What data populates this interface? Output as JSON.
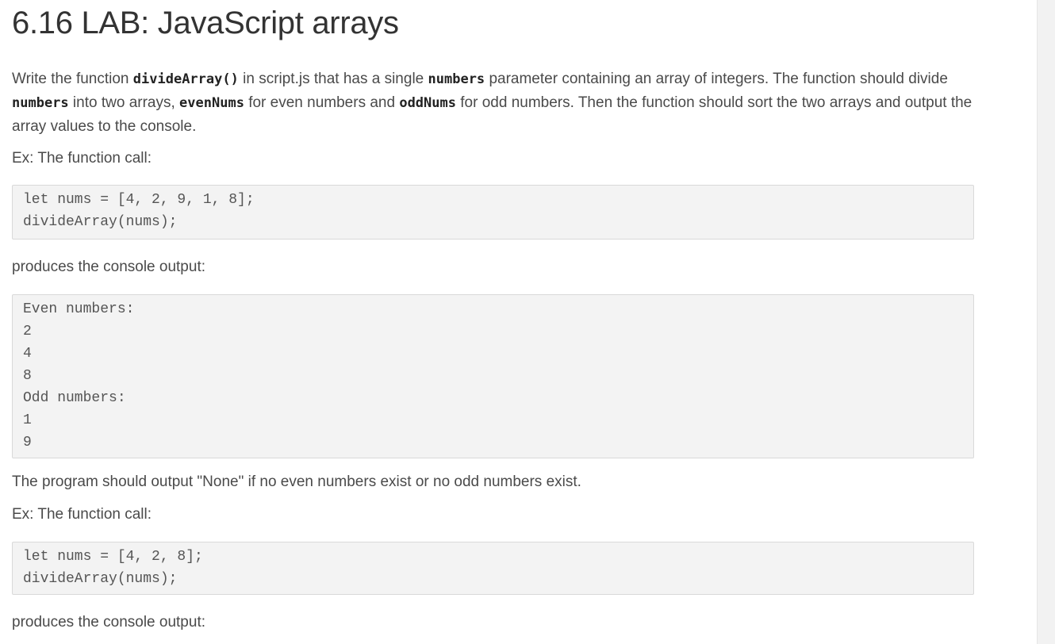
{
  "title": "6.16 LAB: JavaScript arrays",
  "intro": {
    "t1": "Write the function ",
    "c1": "divideArray()",
    "t2": " in script.js that has a single ",
    "c2": "numbers",
    "t3": " parameter containing an array of integers. The function should divide ",
    "c3": "numbers",
    "t4": " into two arrays, ",
    "c4": "evenNums",
    "t5": " for even numbers and ",
    "c5": "oddNums",
    "t6": " for odd numbers. Then the function should sort the two arrays and output the array values to the console."
  },
  "example1_label": "Ex: The function call:",
  "example1_code": [
    "let nums = [4, 2, 9, 1, 8];",
    "divideArray(nums);"
  ],
  "produces1_label": "produces the console output:",
  "output1_lines": [
    "Even numbers:",
    "2",
    "4",
    "8",
    "Odd numbers:",
    "1",
    "9"
  ],
  "none_note": "The program should output \"None\" if no even numbers exist or no odd numbers exist.",
  "example2_label": "Ex: The function call:",
  "example2_code": [
    "let nums = [4, 2, 8];",
    "divideArray(nums);"
  ],
  "produces2_label": "produces the console output:"
}
